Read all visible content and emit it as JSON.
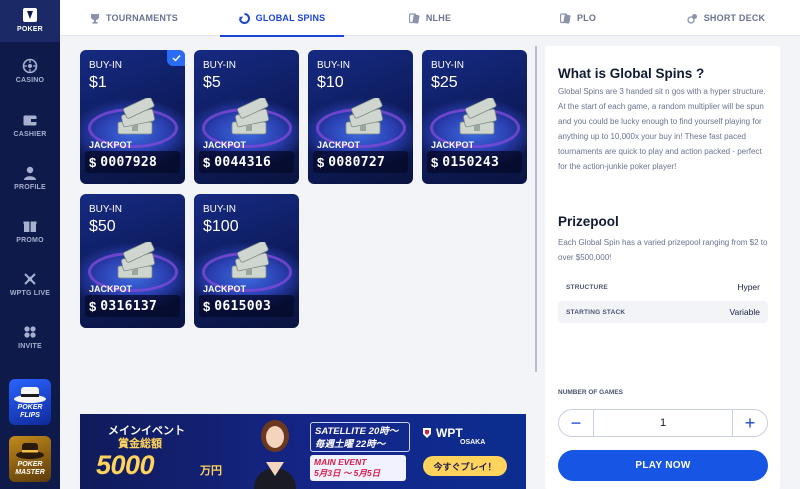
{
  "sidebar": {
    "items": [
      {
        "label": "POKER",
        "icon": "poker-logo-icon",
        "active": true
      },
      {
        "label": "CASINO",
        "icon": "roulette-icon"
      },
      {
        "label": "CASHIER",
        "icon": "wallet-icon"
      },
      {
        "label": "PROFILE",
        "icon": "user-icon"
      },
      {
        "label": "PROMO",
        "icon": "gift-icon"
      },
      {
        "label": "WPTG LIVE",
        "icon": "chips-icon"
      },
      {
        "label": "INVITE",
        "icon": "invite-icon"
      }
    ],
    "promos": [
      {
        "title_line1": "POKER",
        "title_line2": "FLIPS"
      },
      {
        "title_line1": "POKER",
        "title_line2": "MASTER"
      }
    ]
  },
  "tabs": [
    {
      "label": "TOURNAMENTS",
      "icon": "trophy-icon"
    },
    {
      "label": "GLOBAL SPINS",
      "icon": "spin-icon",
      "active": true
    },
    {
      "label": "NLHE",
      "icon": "cards-icon"
    },
    {
      "label": "PLO",
      "icon": "cards-icon"
    },
    {
      "label": "SHORT DECK",
      "icon": "chip-icon"
    }
  ],
  "cards": [
    {
      "buyin_label": "BUY-IN",
      "price": "$1",
      "jackpot_label": "JACKPOT",
      "currency": "$",
      "jackpot": "0007928",
      "selected": true
    },
    {
      "buyin_label": "BUY-IN",
      "price": "$5",
      "jackpot_label": "JACKPOT",
      "currency": "$",
      "jackpot": "0044316"
    },
    {
      "buyin_label": "BUY-IN",
      "price": "$10",
      "jackpot_label": "JACKPOT",
      "currency": "$",
      "jackpot": "0080727"
    },
    {
      "buyin_label": "BUY-IN",
      "price": "$25",
      "jackpot_label": "JACKPOT",
      "currency": "$",
      "jackpot": "0150243"
    },
    {
      "buyin_label": "BUY-IN",
      "price": "$50",
      "jackpot_label": "JACKPOT",
      "currency": "$",
      "jackpot": "0316137"
    },
    {
      "buyin_label": "BUY-IN",
      "price": "$100",
      "jackpot_label": "JACKPOT",
      "currency": "$",
      "jackpot": "0615003"
    }
  ],
  "banner": {
    "title": "メインイベント",
    "subtitle": "賞金総額",
    "amount": "5000",
    "amount_unit": "万円",
    "satellite_line1": "SATELLITE 20時～",
    "satellite_line2": "毎週土曜 22時～",
    "main_event_line1": "MAIN EVENT",
    "main_event_line2": "5月3日 ～ 5月5日",
    "brand": "WPT",
    "brand_city": "OSAKA",
    "cta": "今すぐプレイ！"
  },
  "panel": {
    "title": "What is Global Spins ?",
    "description": "Global Spins are 3 handed sit n gos with a hyper structure. At the start of each game, a random multiplier will be spun and you could be lucky enough to find yourself playing for anything up to 10,000x your buy in! These fast paced tournaments are quick to play and action packed - perfect for the action-junkie poker player!",
    "prizepool_title": "Prizepool",
    "prizepool_text": "Each Global Spin has a varied prizepool ranging from $2 to over $500,000!",
    "attributes": [
      {
        "key": "STRUCTURE",
        "value": "Hyper"
      },
      {
        "key": "STARTING STACK",
        "value": "Variable"
      }
    ],
    "games_label": "NUMBER OF GAMES",
    "minus": "−",
    "games_value": "1",
    "plus": "+",
    "play_label": "PLAY NOW"
  },
  "colors": {
    "accent": "#1755e5",
    "sidebar": "#0d1a4a",
    "card": "#0d1b5c"
  }
}
